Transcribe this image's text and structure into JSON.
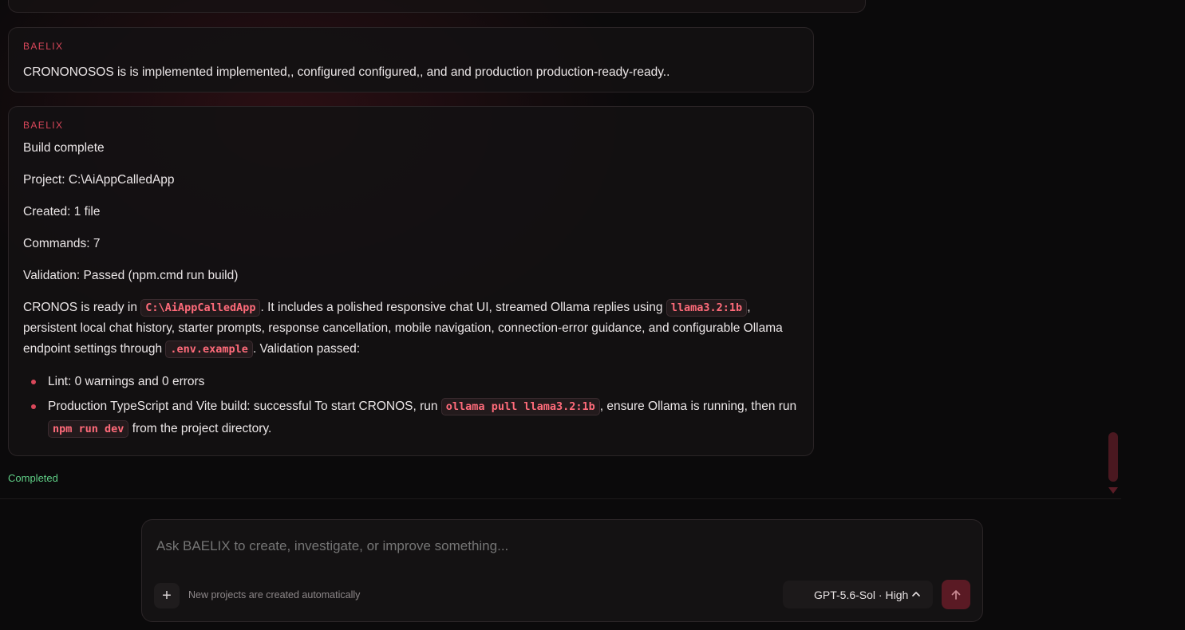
{
  "messages": [
    {
      "sender": "BAELIX",
      "text": "CRONONOSOS is is implemented implemented,, configured configured,, and and production production-ready-ready.."
    },
    {
      "sender": "BAELIX",
      "lines": [
        "Build complete",
        "Project: C:\\AiAppCalledApp",
        "Created: 1 file",
        "Commands: 7",
        "Validation: Passed (npm.cmd run build)"
      ],
      "summary": {
        "t1": "CRONOS is ready in ",
        "code1": "C:\\AiAppCalledApp",
        "t2": ". It includes a polished responsive chat UI, streamed Ollama replies using ",
        "code2": "llama3.2:1b",
        "t3": ", persistent local chat history, starter prompts, response cancellation, mobile navigation, connection-error guidance, and configurable Ollama endpoint settings through ",
        "code3": ".env.example",
        "t4": ". Validation passed:"
      },
      "bullets": {
        "b1": "Lint: 0 warnings and 0 errors",
        "b2_t1": "Production TypeScript and Vite build: successful To start CRONOS, run ",
        "b2_code1": "ollama pull llama3.2:1b",
        "b2_t2": ", ensure Ollama is running, then run ",
        "b2_code2": "npm run dev",
        "b2_t3": " from the project directory."
      }
    }
  ],
  "status": {
    "text": "Completed",
    "color": "#5fcf86"
  },
  "composer": {
    "placeholder": "Ask BAELIX to create, investigate, or improve something...",
    "add_icon": "+",
    "hint": "New projects are created automatically",
    "model_label": "GPT-5.6-Sol · High",
    "send_icon": "arrow-up-icon"
  },
  "colors": {
    "accent": "#d9475a",
    "code": "#ff6b7a",
    "send": "#5a1a24"
  }
}
